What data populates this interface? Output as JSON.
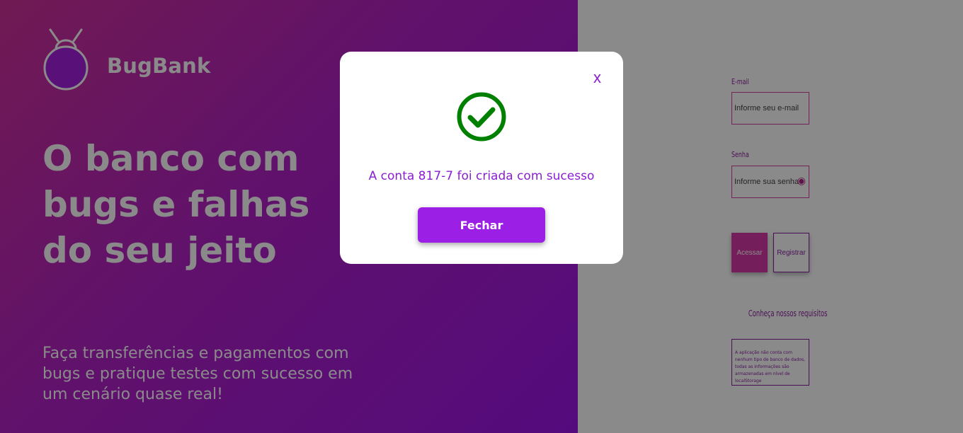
{
  "brand": {
    "name": "BugBank"
  },
  "hero": {
    "headline_lines": [
      "O banco com",
      "bugs e falhas",
      "do seu jeito"
    ],
    "subtext": "Faça transferências e pagamentos com bugs e pratique testes com sucesso em um cenário quase real!"
  },
  "login": {
    "email_label": "E-mail",
    "email_placeholder": "Informe seu e-mail",
    "password_label": "Senha",
    "password_placeholder": "Informe sua senha",
    "access_label": "Acessar",
    "register_label": "Registrar",
    "requirements_link": "Conheça nossos requisitos",
    "info_text": "A aplicação não conta com nenhum tipo de banco de dados, todas as informações são armazenadas em nível de localStorage"
  },
  "modal": {
    "close_label": "x",
    "message": "A conta 817-7 foi criada com sucesso",
    "button_label": "Fechar"
  },
  "colors": {
    "hero_gradient_start": "#d0319a",
    "hero_gradient_end": "#9c14e8",
    "accent_purple": "#9c1fe6",
    "success_green": "#008000"
  },
  "icons": {
    "logo": "bug-icon",
    "success": "check-circle-icon",
    "password_toggle": "eye-icon"
  }
}
